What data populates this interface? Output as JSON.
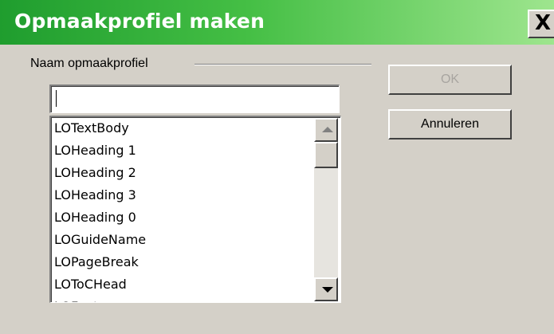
{
  "window": {
    "title": "Opmaakprofiel maken",
    "close_glyph": "X"
  },
  "form": {
    "group_label": "Naam opmaakprofiel",
    "name_value": "",
    "styles": [
      "LOTextBody",
      "LOHeading 1",
      "LOHeading 2",
      "LOHeading 3",
      "LOHeading 0",
      "LOGuideName",
      "LOPageBreak",
      "LOToCHead",
      "LOFooter"
    ]
  },
  "buttons": {
    "ok": "OK",
    "cancel": "Annuleren",
    "ok_enabled": false
  },
  "scrollbar": {
    "position_fraction": 0.05
  },
  "colors": {
    "title_gradient_start": "#1f9d2e",
    "title_gradient_end": "#9ee58e",
    "dialog_bg": "#d4d0c8"
  },
  "icons": {
    "close": "close-icon",
    "scroll_up": "scroll-up-arrow-icon",
    "scroll_down": "scroll-down-arrow-icon"
  }
}
